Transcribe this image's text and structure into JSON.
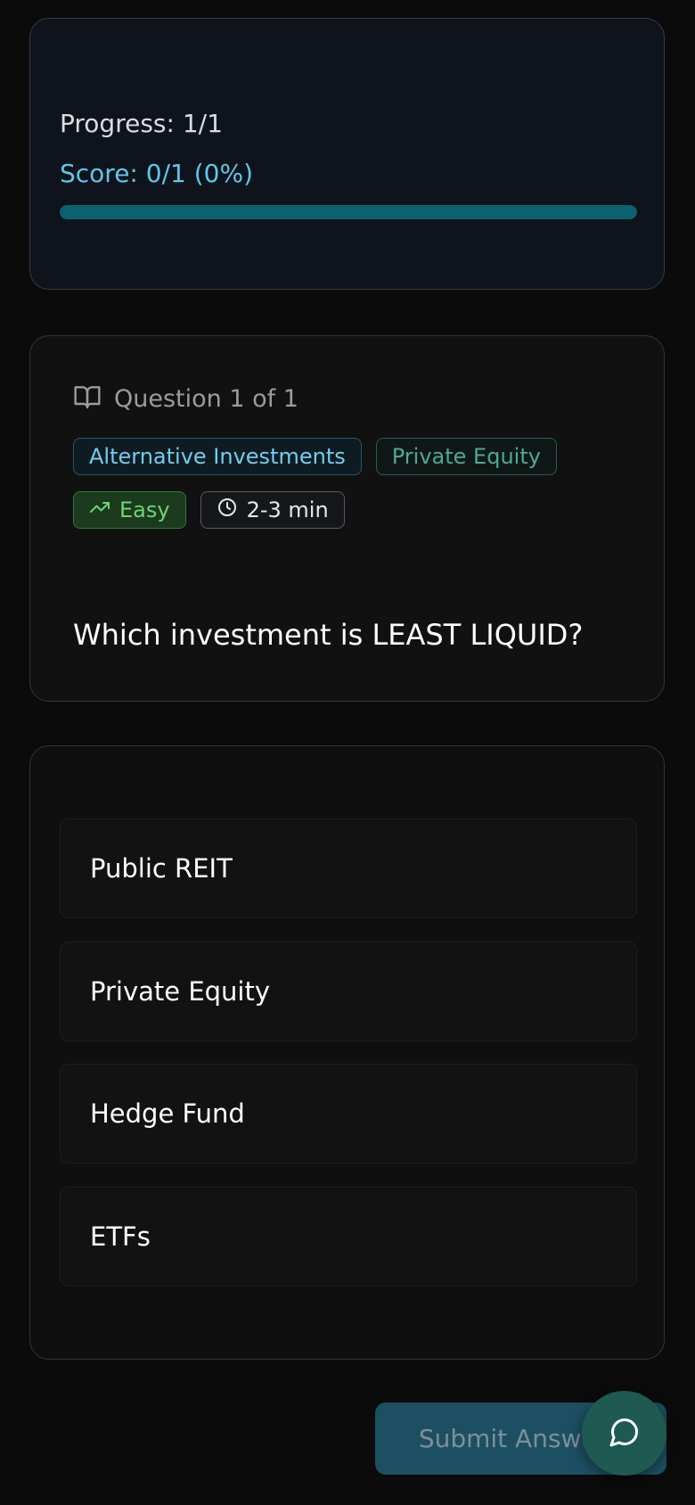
{
  "progress": {
    "label": "Progress: 1/1",
    "score": "Score: 0/1 (0%)",
    "fill_fraction": 1.0
  },
  "question": {
    "counter": "Question 1 of 1",
    "tags": {
      "topic": "Alternative Investments",
      "subtopic": "Private Equity",
      "difficulty": "Easy",
      "time": "2-3 min"
    },
    "text": "Which investment is LEAST LIQUID?"
  },
  "answers": [
    {
      "label": "Public REIT"
    },
    {
      "label": "Private Equity"
    },
    {
      "label": "Hedge Fund"
    },
    {
      "label": "ETFs"
    }
  ],
  "submit": {
    "label": "Submit Answer"
  },
  "icons": {
    "question": "book-open-icon",
    "difficulty": "trending-up-icon",
    "time": "clock-icon",
    "chat": "message-circle-icon"
  },
  "colors": {
    "accent": "#5cc8ea",
    "progress_fill": "#0b6170",
    "easy": "#6ed474",
    "submit_bg": "#1d4f63",
    "chat_fab": "#1e5a51"
  }
}
